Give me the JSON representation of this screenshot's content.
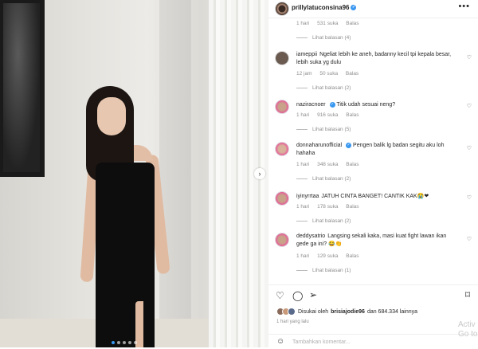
{
  "post": {
    "username": "prillylatuconsina96",
    "more_label": "•••"
  },
  "comments": [
    {
      "user": "",
      "text": "",
      "time": "1 hari",
      "likes": "531 suka",
      "reply": "Balas",
      "view_replies": "Lihat balasan (4)"
    },
    {
      "user": "iameppii",
      "text": "Ngeliat lebih ke aneh, badanny kecil tpi kepala besar, lebih suka yg dulu",
      "time": "12 jam",
      "likes": "50 suka",
      "reply": "Balas",
      "view_replies": "Lihat balasan (2)"
    },
    {
      "user": "naziracnoer",
      "text": "Titik udah sesuai neng?",
      "time": "1 hari",
      "likes": "916 suka",
      "reply": "Balas",
      "view_replies": "Lihat balasan (5)"
    },
    {
      "user": "donnaharunofficial",
      "text": "Pengen balik lg badan segitu aku loh hahaha",
      "time": "1 hari",
      "likes": "348 suka",
      "reply": "Balas",
      "view_replies": "Lihat balasan (2)"
    },
    {
      "user": "iyinyrrtaa",
      "text": "JATUH CINTA BANGET! CANTIK KAK😭❤",
      "time": "1 hari",
      "likes": "178 suka",
      "reply": "Balas",
      "view_replies": "Lihat balasan (2)"
    },
    {
      "user": "deddysatrio",
      "text": "Langsing sekali kaka, masi kuat fight lawan ikan gede ga ini? 😂👏",
      "time": "1 hari",
      "likes": "129 suka",
      "reply": "Balas",
      "view_replies": "Lihat balasan (1)"
    }
  ],
  "likes_summary": {
    "prefix": "Disukai oleh",
    "user": "brisiajodie96",
    "suffix": "dan 684.334 lainnya"
  },
  "posted_time": "1 hari yang lalu",
  "comment_input": {
    "placeholder": "Tambahkan komentar..."
  },
  "watermark": {
    "line1": "Activ",
    "line2": "Go to"
  },
  "icons": [
    "heart-icon",
    "comment-icon",
    "share-icon",
    "bookmark-icon",
    "smile-icon",
    "more-icon",
    "chevron-right-icon"
  ],
  "colors": {
    "accent": "#3897f0",
    "muted": "#8e8e8e",
    "text": "#262626"
  }
}
